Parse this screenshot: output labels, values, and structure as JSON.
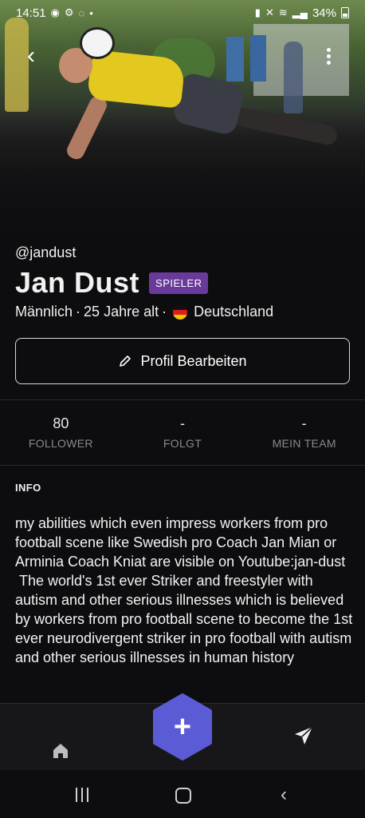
{
  "status_bar": {
    "time": "14:51",
    "battery": "34%"
  },
  "profile": {
    "handle": "@jandust",
    "name": "Jan Dust",
    "role_badge": "SPIELER",
    "gender": "Männlich",
    "separator": "·",
    "age": "25 Jahre alt",
    "country": "Deutschland",
    "edit_button_label": "Profil Bearbeiten"
  },
  "stats": [
    {
      "value": "80",
      "label": "FOLLOWER"
    },
    {
      "value": "-",
      "label": "FOLGT"
    },
    {
      "value": "-",
      "label": "MEIN TEAM"
    }
  ],
  "info": {
    "title": "INFO",
    "text": "my abilities which even impress workers from pro football scene like Swedish pro Coach Jan Mian or Arminia Coach Kniat are visible on Youtube:jan-dust\n The world's 1st ever Striker and freestyler with autism and other serious illnesses which is believed by workers from pro football scene to become the 1st ever neurodivergent striker in pro football with autism and other serious illnesses in human history"
  },
  "icons": {
    "back": "back-arrow-icon",
    "more": "more-vertical-icon",
    "edit": "pencil-icon",
    "home": "home-icon",
    "add": "plus-icon",
    "send": "send-icon"
  },
  "colors": {
    "background": "#0d0d0f",
    "badge": "#6a3a9a",
    "fab": "#5b5bd6",
    "muted_text": "#8a8a8f"
  }
}
